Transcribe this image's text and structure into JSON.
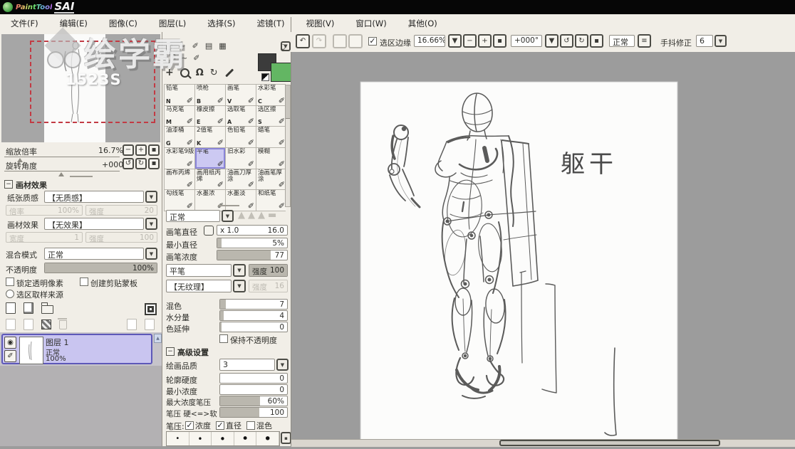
{
  "window": {
    "brand": "PaintTool",
    "app": "SAI"
  },
  "icons": {
    "pencil": "✐",
    "undo": "↶",
    "redo": "↷",
    "rotate_ccw": "↺",
    "rotate_cw": "↻",
    "dropdown": "▼",
    "up": "▲",
    "minus": "−",
    "plus": "+",
    "square": "▪",
    "check": "✓",
    "eye": "◉",
    "dot": "•",
    "menu": "≡",
    "move": "+",
    "rotate_canvas": "Ω",
    "hatch1": "▤",
    "hatch2": "▦",
    "marquee": "▢",
    "curve": "~",
    "swap": "⤸"
  },
  "menu": {
    "items": [
      {
        "label": "文件(F)"
      },
      {
        "label": "编辑(E)"
      },
      {
        "label": "图像(C)"
      },
      {
        "label": "图层(L)"
      },
      {
        "label": "选择(S)"
      },
      {
        "label": "滤镜(T)"
      },
      {
        "label": "视图(V)"
      },
      {
        "label": "窗口(W)"
      },
      {
        "label": "其他(O)"
      }
    ]
  },
  "toolbar": {
    "selection_edge_label": "选区边缘",
    "selection_edge_checked": true,
    "zoom_value": "16.66%",
    "zoom_buttons": [
      {
        "g": "▼"
      },
      {
        "g": "−"
      },
      {
        "g": "+"
      },
      {
        "g": "▪"
      }
    ],
    "angle_value": "+000°",
    "angle_buttons": [
      {
        "g": "▼"
      },
      {
        "g": "↺"
      },
      {
        "g": "↻"
      },
      {
        "g": "▪"
      }
    ],
    "blend_mode": "正常",
    "stabilizer_label": "手抖修正",
    "stabilizer_value": "6"
  },
  "navigator": {
    "zoom_label": "缩放倍率",
    "zoom_value": "16.7%",
    "angle_label": "旋转角度",
    "angle_value": "+000",
    "zoom_buttons": [
      {
        "g": "−"
      },
      {
        "g": "+"
      },
      {
        "g": "▪"
      }
    ],
    "angle_buttons": [
      {
        "g": "↺"
      },
      {
        "g": "↻"
      },
      {
        "g": "▪"
      }
    ]
  },
  "material": {
    "header": "画材效果",
    "paper_label": "纸张质感",
    "paper_value": "【无质感】",
    "paper_scale_label": "倍率",
    "paper_scale_value": "100%",
    "paper_strength_label": "强度",
    "paper_strength_value": "20",
    "effect_label": "画材效果",
    "effect_value": "【无效果】",
    "effect_width_label": "宽度",
    "effect_width_value": "1",
    "effect_strength_label": "强度",
    "effect_strength_value": "100"
  },
  "layer_panel": {
    "blend_label": "混合模式",
    "blend_value": "正常",
    "opacity_label": "不透明度",
    "opacity_value": "100%",
    "opacity_fill": 100,
    "lock_alpha_label": "锁定透明像素",
    "lock_alpha_checked": false,
    "clip_label": "创建剪贴蒙板",
    "clip_checked": false,
    "selection_source_label": "选区取样来源",
    "layers": [
      {
        "name": "图层 1",
        "mode": "正常",
        "opacity": "100%"
      }
    ]
  },
  "color": {
    "foreground": "#3b3b3b",
    "background": "#63b663"
  },
  "brushes": {
    "items": [
      {
        "name": "铅笔",
        "key": "N"
      },
      {
        "name": "喷枪",
        "key": "B"
      },
      {
        "name": "画笔",
        "key": "V"
      },
      {
        "name": "水彩笔",
        "key": "C"
      },
      {
        "name": "马克笔",
        "key": "M"
      },
      {
        "name": "橡皮擦",
        "key": "E"
      },
      {
        "name": "选取笔",
        "key": "A"
      },
      {
        "name": "选区擦",
        "key": "S"
      },
      {
        "name": "油漆桶",
        "key": "G"
      },
      {
        "name": "2值笔",
        "key": "K"
      },
      {
        "name": "色铅笔",
        "key": ""
      },
      {
        "name": "蜡笔",
        "key": ""
      },
      {
        "name": "水彩笔9版",
        "key": ""
      },
      {
        "name": "平笔",
        "key": "",
        "sel": "1"
      },
      {
        "name": "旧水彩",
        "key": ""
      },
      {
        "name": "模糊",
        "key": ""
      },
      {
        "name": "画布丙烯",
        "key": ""
      },
      {
        "name": "画用纸丙烯",
        "key": ""
      },
      {
        "name": "油画刀厚涂",
        "key": ""
      },
      {
        "name": "油画笔厚涂",
        "key": ""
      },
      {
        "name": "勾线笔",
        "key": ""
      },
      {
        "name": "水墨浓",
        "key": ""
      },
      {
        "name": "水墨淡",
        "key": ""
      },
      {
        "name": "和纸笔",
        "key": ""
      }
    ]
  },
  "brush_settings": {
    "mode": "正常",
    "tip_shapes": [
      {
        "g": "▲"
      },
      {
        "g": "▲"
      },
      {
        "g": "▲"
      },
      {
        "g": "▬"
      }
    ],
    "diameter_label": "画笔直径",
    "diameter_prefix": "x 1.0",
    "diameter_value": "16.0",
    "min_size_label": "最小直径",
    "min_size_value": "5%",
    "min_size_fill": 6,
    "density_label": "画笔浓度",
    "density_value": "77",
    "density_fill": 77,
    "tip_value": "平笔",
    "tip_strength_label": "强度",
    "tip_strength_value": "100",
    "tip_strength_fill": 100,
    "texture_value": "【无纹理】",
    "texture_strength_label": "强度",
    "texture_strength_value": "16",
    "blend_label": "混色",
    "blend_value": "7",
    "blend_fill": 8,
    "water_label": "水分量",
    "water_value": "4",
    "water_fill": 5,
    "spread_label": "色延伸",
    "spread_value": "0",
    "spread_fill": 2,
    "keep_opacity_label": "保持不透明度",
    "keep_opacity_checked": false,
    "advanced_header": "高级设置",
    "quality_label": "绘画品质",
    "quality_value": "3",
    "edge_label": "轮廓硬度",
    "edge_value": "0",
    "edge_fill": 0,
    "min_density_label": "最小浓度",
    "min_density_value": "0",
    "min_density_fill": 0,
    "max_density_label": "最大浓度笔压",
    "max_density_value": "60%",
    "max_density_fill": 60,
    "pressure_label": "笔压 硬<=>软",
    "pressure_value": "100",
    "pressure_fill": 58,
    "pressure_row_label": "笔压:",
    "pressure_checks": [
      {
        "label": "浓度",
        "on": true
      },
      {
        "label": "直径",
        "on": true
      },
      {
        "label": "混色",
        "on": false
      }
    ],
    "size_presets": [
      {
        "s": "10"
      },
      {
        "s": "12"
      },
      {
        "s": "15"
      },
      {
        "s": "17"
      },
      {
        "s": "19"
      }
    ]
  },
  "canvas": {
    "annotation": "躯干"
  },
  "watermark": {
    "brand": "绘学霸",
    "code": "1523S"
  }
}
